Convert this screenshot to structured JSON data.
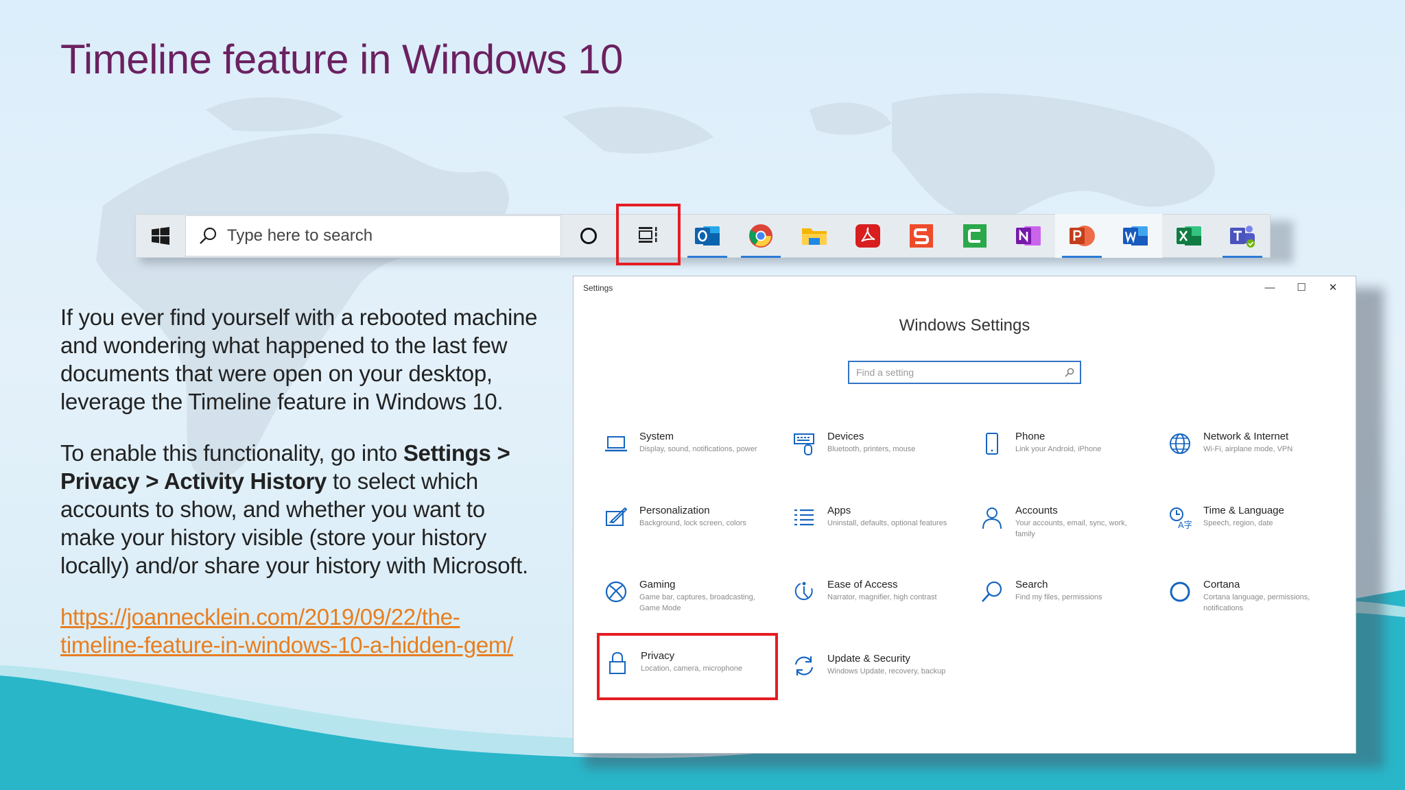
{
  "slide": {
    "title": "Timeline feature in Windows 10",
    "paragraph1": "If you ever find yourself with a rebooted machine and wondering what happened to the last few documents that were open on your desktop, leverage the Timeline feature in Windows 10.",
    "paragraph2": {
      "lead": "To enable this functionality, go into ",
      "path_a": "Settings > Privacy > Activity History",
      "rest": " to select which accounts to show, and whether you want to make your history visible (store your history locally) and/or share your history with Microsoft."
    },
    "link": "https://joannecklein.com/2019/09/22/the-timeline-feature-in-windows-10-a-hidden-gem/"
  },
  "taskbar": {
    "search_placeholder": "Type here to search",
    "icons": [
      "windows-start-icon",
      "search-icon",
      "cortana-icon",
      "timeline-icon",
      "outlook-icon",
      "chrome-icon",
      "file-explorer-icon",
      "acrobat-icon",
      "snagit-icon",
      "camtasia-icon",
      "onenote-icon",
      "powerpoint-icon",
      "word-icon",
      "excel-icon",
      "teams-icon"
    ]
  },
  "settings": {
    "window_title": "Settings",
    "controls": {
      "minimize": "—",
      "maximize": "☐",
      "close": "✕"
    },
    "heading": "Windows Settings",
    "search_placeholder": "Find a setting",
    "tiles": [
      {
        "name": "System",
        "desc": "Display, sound, notifications, power",
        "icon": "laptop-icon"
      },
      {
        "name": "Devices",
        "desc": "Bluetooth, printers, mouse",
        "icon": "keyboard-icon"
      },
      {
        "name": "Phone",
        "desc": "Link your Android, iPhone",
        "icon": "phone-icon"
      },
      {
        "name": "Network & Internet",
        "desc": "Wi-Fi, airplane mode, VPN",
        "icon": "globe-icon"
      },
      {
        "name": "Personalization",
        "desc": "Background, lock screen, colors",
        "icon": "paint-icon"
      },
      {
        "name": "Apps",
        "desc": "Uninstall, defaults, optional features",
        "icon": "list-icon"
      },
      {
        "name": "Accounts",
        "desc": "Your accounts, email, sync, work, family",
        "icon": "person-icon"
      },
      {
        "name": "Time & Language",
        "desc": "Speech, region, date",
        "icon": "language-icon"
      },
      {
        "name": "Gaming",
        "desc": "Game bar, captures, broadcasting, Game Mode",
        "icon": "xbox-icon"
      },
      {
        "name": "Ease of Access",
        "desc": "Narrator, magnifier, high contrast",
        "icon": "ease-of-access-icon"
      },
      {
        "name": "Search",
        "desc": "Find my files, permissions",
        "icon": "magnifier-icon"
      },
      {
        "name": "Cortana",
        "desc": "Cortana language, permissions, notifications",
        "icon": "cortana-ring-icon"
      },
      {
        "name": "Privacy",
        "desc": "Location, camera, microphone",
        "icon": "lock-icon"
      },
      {
        "name": "Update & Security",
        "desc": "Windows Update, recovery, backup",
        "icon": "sync-icon"
      }
    ]
  },
  "colors": {
    "title": "#6b2160",
    "highlight": "#e51c23",
    "link": "#e87e1f",
    "settings_icon": "#1565c0",
    "teal_wave": "#29b6c9"
  }
}
